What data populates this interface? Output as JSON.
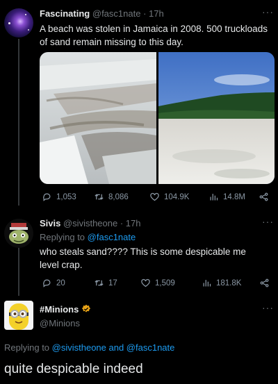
{
  "tweet1": {
    "display_name": "Fascinating",
    "handle": "@fasc1nate",
    "time": "· 17h",
    "text": "A beach was stolen in Jamaica in 2008.  500 truckloads of sand remain missing to this day.",
    "stats": {
      "replies": "1,053",
      "retweets": "8,086",
      "likes": "104.9K",
      "views": "14.8M"
    }
  },
  "tweet2": {
    "display_name": "Sivis",
    "handle": "@sivistheone",
    "time": "· 17h",
    "replying_prefix": "Replying to ",
    "replying_to": "@fasc1nate",
    "text": "who steals sand???? This is some despicable me level crap.",
    "stats": {
      "replies": "20",
      "retweets": "17",
      "likes": "1,509",
      "views": "181.8K"
    }
  },
  "tweet3": {
    "display_name": "#Minions",
    "handle": "@Minions",
    "replying_prefix": "Replying to ",
    "replying_to": "@sivistheone and @fasc1nate",
    "text": "quite despicable indeed"
  },
  "icons": [
    "reply-icon",
    "retweet-icon",
    "like-icon",
    "views-icon",
    "share-icon",
    "more-icon",
    "verified-badge-icon"
  ],
  "colors": {
    "background": "#000000",
    "text": "#e7e9ea",
    "muted": "#71767b",
    "link": "#1d9bf0",
    "verified": "#e8a317"
  }
}
